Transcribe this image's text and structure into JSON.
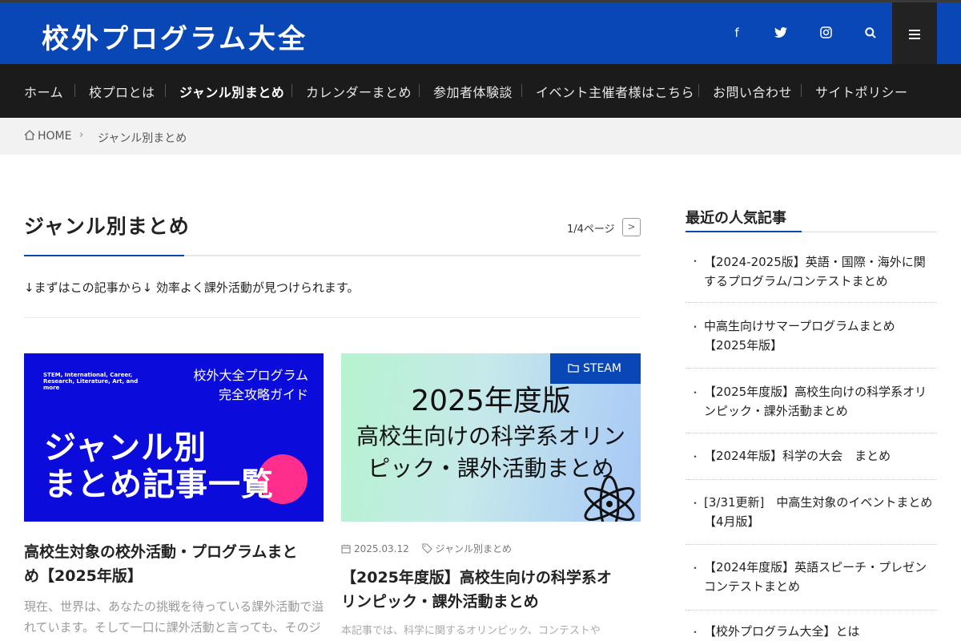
{
  "site": {
    "title": "校外プログラム大全"
  },
  "social": [
    {
      "name": "facebook-icon",
      "glyph": "f"
    },
    {
      "name": "twitter-icon",
      "glyph": "🐦"
    },
    {
      "name": "instagram-icon",
      "glyph": "◎"
    },
    {
      "name": "search-icon",
      "glyph": "⚲"
    }
  ],
  "nav": {
    "items": [
      "ホーム",
      "校プロとは",
      "ジャンル別まとめ",
      "カレンダーまとめ",
      "参加者体験談",
      "イベント主催者様はこちら",
      "お問い合わせ",
      "サイトポリシー"
    ],
    "active": "ジャンル別まとめ"
  },
  "breadcrumb": {
    "home": "HOME",
    "separator": "›",
    "current": "ジャンル別まとめ"
  },
  "page": {
    "title": "ジャンル別まとめ",
    "pager": "1/4ページ",
    "pager_next": ">",
    "intro": "↓まずはこの記事から↓ 効率よく課外活動が見つけられます。"
  },
  "cards": [
    {
      "thumb_small": "STEM, International, Career, Research, Literature, Art, and more",
      "thumb_guide_1": "校外大全プログラム",
      "thumb_guide_2": "完全攻略ガイド",
      "thumb_big_1": "ジャンル別",
      "thumb_big_2": "まとめ記事一覧",
      "title_1": "高校生対象の校外活動・プログラムまと",
      "title_2": "め【2025年版】",
      "excerpt_1": "現在、世界は、あなたの挑戦を待っている課外活動で溢",
      "excerpt_2": "れています。そして一口に課外活動と言っても、そのジ"
    },
    {
      "category": "STEAM",
      "thumb_year": "2025年度版",
      "thumb_line2": "高校生向けの科学系オリン",
      "thumb_line3": "ピック・課外活動まとめ",
      "date": "2025.03.12",
      "tag": "ジャンル別まとめ",
      "title_1": "【2025年度版】高校生向けの科学系オ",
      "title_2": "リンピック・課外活動まとめ",
      "excerpt": "本記事では、科学に関するオリンピック、コンテストや"
    }
  ],
  "sidebar": {
    "heading": "最近の人気記事",
    "items": [
      {
        "l1": "【2024-2025版】英語・国際・海外に関",
        "l2": "するプログラム/コンテストまとめ"
      },
      {
        "l1": "中高生向けサマープログラムまとめ",
        "l2": "【2025年版】"
      },
      {
        "l1": "【2025年度版】高校生向けの科学系オリ",
        "l2": "ンピック・課外活動まとめ"
      },
      {
        "l1": "【2024年版】科学の大会　まとめ",
        "l2": ""
      },
      {
        "l1": "[3/31更新]　中高生対象のイベントまとめ",
        "l2": "【4月版】"
      },
      {
        "l1": "【2024年度版】英語スピーチ・プレゼン",
        "l2": "コンテストまとめ"
      },
      {
        "l1": "【校外プログラム大全】とは",
        "l2": ""
      }
    ]
  },
  "colors": {
    "brand": "#0a47b6",
    "nav_bg": "#1b1b1b",
    "accent_pink": "#ff2d8c",
    "thumb_blue": "#0b0bdc"
  }
}
